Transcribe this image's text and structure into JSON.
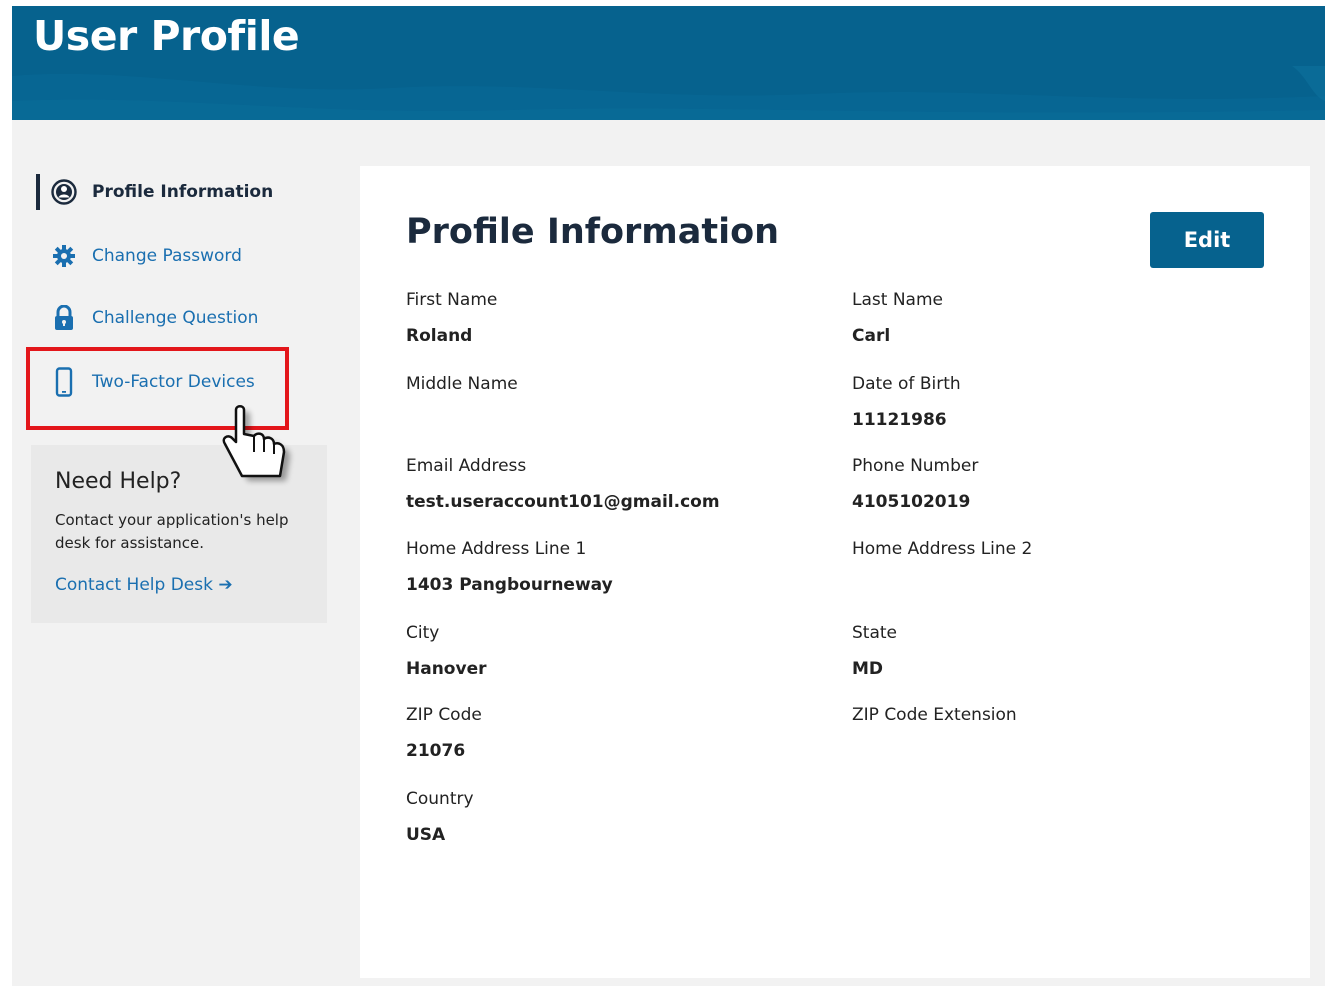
{
  "header": {
    "title": "User Profile",
    "color": "#06628e"
  },
  "sidebar": {
    "items": [
      {
        "label": "Profile Information",
        "icon": "user-circle-icon",
        "active": true
      },
      {
        "label": "Change Password",
        "icon": "gear-icon",
        "active": false
      },
      {
        "label": "Challenge Question",
        "icon": "lock-icon",
        "active": false
      },
      {
        "label": "Two-Factor Devices",
        "icon": "mobile-phone-icon",
        "active": false
      }
    ],
    "help": {
      "title": "Need Help?",
      "text": "Contact your application's help desk for assistance.",
      "link": "Contact Help Desk ➔"
    }
  },
  "main": {
    "title": "Profile Information",
    "edit_label": "Edit",
    "fields": {
      "first_name": {
        "label": "First Name",
        "value": "Roland"
      },
      "last_name": {
        "label": "Last Name",
        "value": "Carl"
      },
      "middle_name": {
        "label": "Middle Name",
        "value": ""
      },
      "date_of_birth": {
        "label": "Date of Birth",
        "value": "11121986"
      },
      "email": {
        "label": "Email Address",
        "value": "test.useraccount101@gmail.com"
      },
      "phone": {
        "label": "Phone Number",
        "value": "4105102019"
      },
      "address1": {
        "label": "Home Address Line 1",
        "value": "1403 Pangbourneway"
      },
      "address2": {
        "label": "Home Address Line 2",
        "value": ""
      },
      "city": {
        "label": "City",
        "value": "Hanover"
      },
      "state": {
        "label": "State",
        "value": "MD"
      },
      "zip": {
        "label": "ZIP Code",
        "value": "21076"
      },
      "zip_ext": {
        "label": "ZIP Code Extension",
        "value": ""
      },
      "country": {
        "label": "Country",
        "value": "USA"
      }
    }
  },
  "colors": {
    "accent": "#06628e",
    "link": "#1a6fb0",
    "highlight": "#e3161b"
  }
}
